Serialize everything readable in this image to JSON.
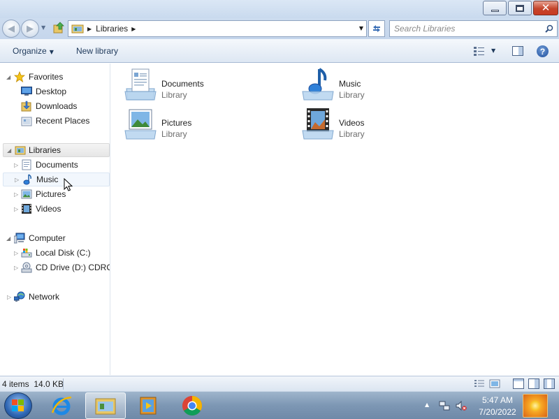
{
  "window": {
    "controls": {
      "minimize": "minimize",
      "maximize": "restore",
      "close": "close"
    }
  },
  "address": {
    "path": "Libraries",
    "search_placeholder": "Search Libraries"
  },
  "toolbar": {
    "organize_label": "Organize",
    "new_library_label": "New library"
  },
  "sidebar": {
    "favorites": {
      "label": "Favorites",
      "items": [
        {
          "label": "Desktop",
          "icon": "desktop-icon"
        },
        {
          "label": "Downloads",
          "icon": "downloads-icon"
        },
        {
          "label": "Recent Places",
          "icon": "recent-places-icon"
        }
      ]
    },
    "libraries": {
      "label": "Libraries",
      "items": [
        {
          "label": "Documents",
          "icon": "documents-icon"
        },
        {
          "label": "Music",
          "icon": "music-icon"
        },
        {
          "label": "Pictures",
          "icon": "pictures-icon"
        },
        {
          "label": "Videos",
          "icon": "videos-icon"
        }
      ]
    },
    "computer": {
      "label": "Computer",
      "items": [
        {
          "label": "Local Disk (C:)",
          "icon": "local-disk-icon"
        },
        {
          "label": "CD Drive (D:) CDROM",
          "icon": "cd-drive-icon"
        }
      ]
    },
    "network": {
      "label": "Network"
    }
  },
  "content": {
    "libraries": [
      {
        "name": "Documents",
        "type": "Library",
        "icon": "documents-library-icon"
      },
      {
        "name": "Music",
        "type": "Library",
        "icon": "music-library-icon"
      },
      {
        "name": "Pictures",
        "type": "Library",
        "icon": "pictures-library-icon"
      },
      {
        "name": "Videos",
        "type": "Library",
        "icon": "videos-library-icon"
      }
    ]
  },
  "status": {
    "item_count": "4 items",
    "size": "14.0 KB"
  },
  "taskbar": {
    "apps": [
      {
        "name": "internet-explorer-icon"
      },
      {
        "name": "windows-explorer-icon",
        "active": true
      },
      {
        "name": "media-player-icon"
      },
      {
        "name": "chrome-icon"
      }
    ],
    "clock": {
      "time": "5:47 AM",
      "date": "7/20/2022"
    }
  },
  "colors": {
    "frame": "#c9daee",
    "toolbar_text": "#1e395b",
    "close_button": "#c93b22",
    "taskbar": "#7d97b4"
  }
}
